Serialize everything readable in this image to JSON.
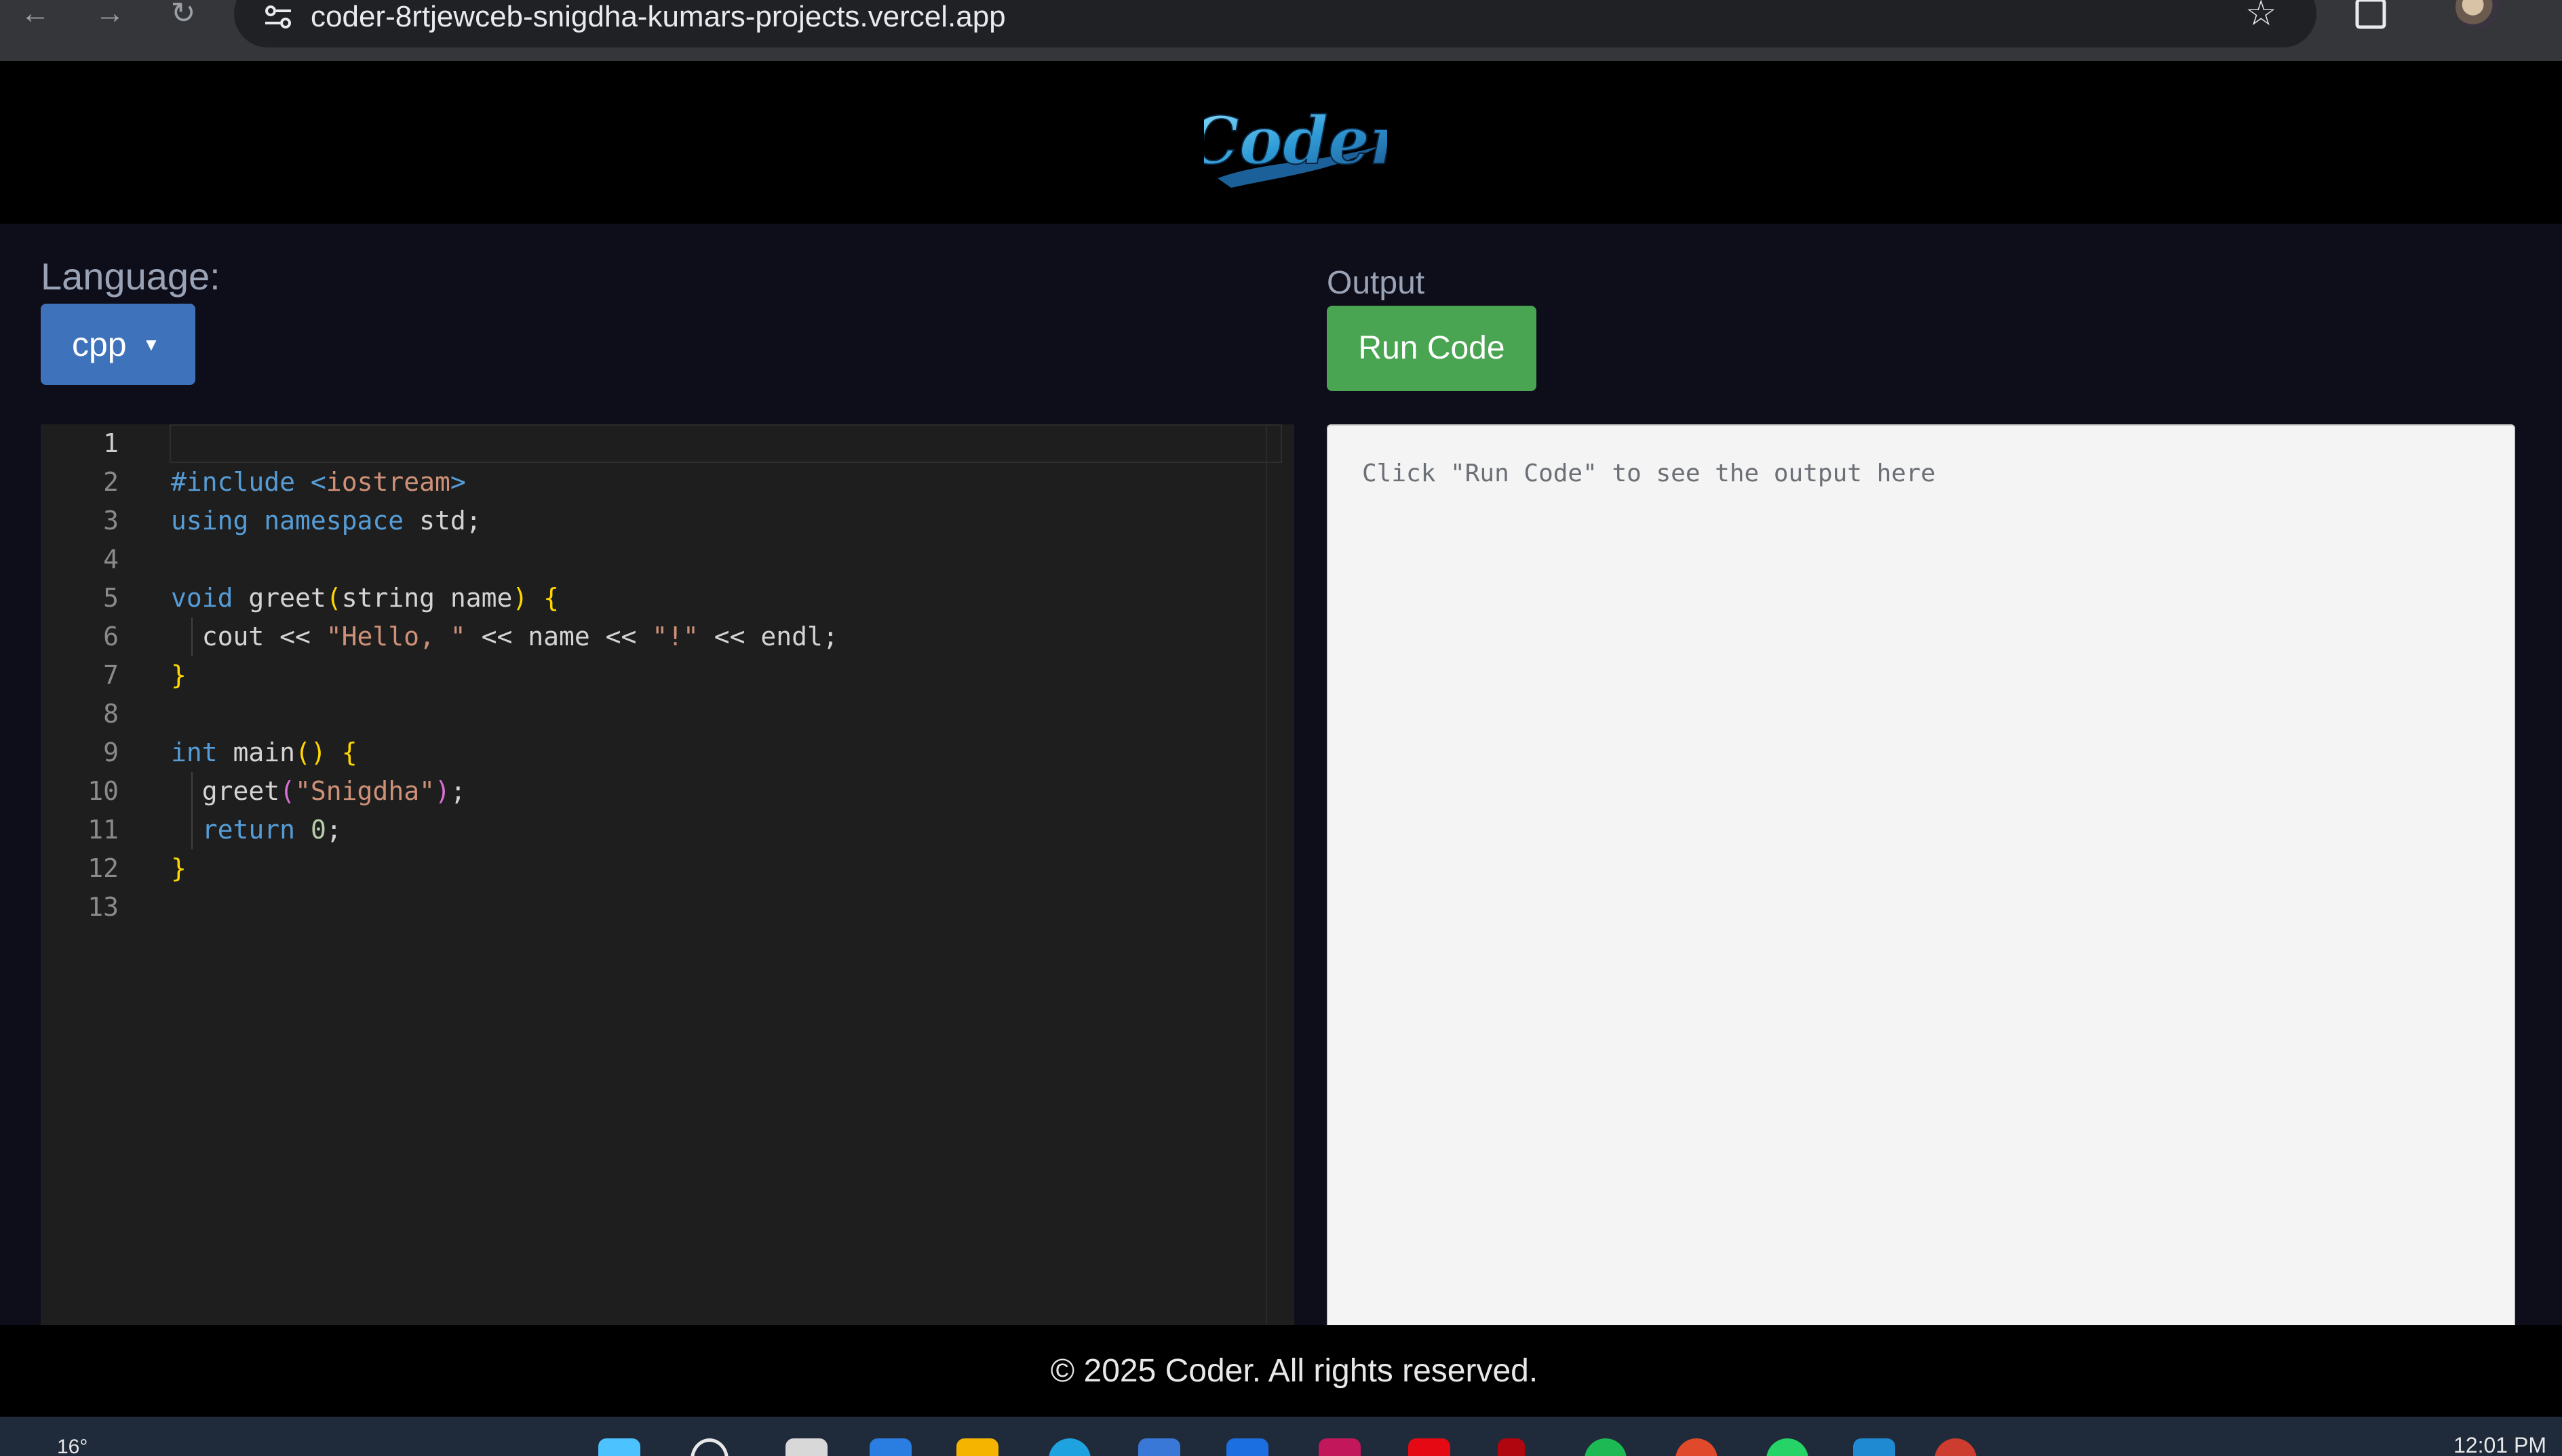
{
  "browser": {
    "url": "coder-8rtjewceb-snigdha-kumars-projects.vercel.app",
    "back_icon": "arrow-left-icon",
    "forward_icon": "arrow-right-icon",
    "reload_icon": "reload-icon",
    "star_icon": "star-icon",
    "extensions_icon": "extensions-icon"
  },
  "header": {
    "logo_text": "Coder"
  },
  "toolbar": {
    "language_label": "Language:",
    "language_value": "cpp",
    "output_label": "Output",
    "run_label": "Run Code"
  },
  "editor": {
    "line_numbers": [
      "1",
      "2",
      "3",
      "4",
      "5",
      "6",
      "7",
      "8",
      "9",
      "10",
      "11",
      "12",
      "13"
    ],
    "active_line": "1"
  },
  "output": {
    "placeholder": "Click \"Run Code\" to see the output here"
  },
  "footer": {
    "text": "© 2025 Coder. All rights reserved."
  },
  "taskbar": {
    "weather": "16°",
    "time": "12:01 PM"
  },
  "colors": {
    "accent_blue": "#3e72bb",
    "run_green": "#4aa552",
    "page_bg": "#0e0d1a",
    "editor_bg": "#1e1e1e"
  }
}
